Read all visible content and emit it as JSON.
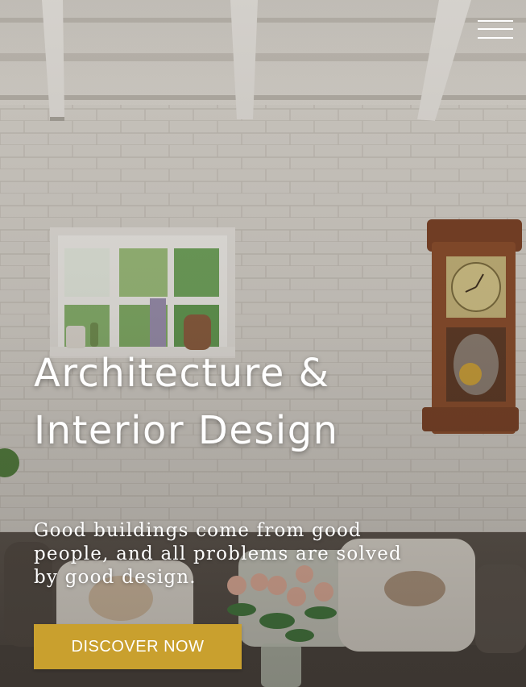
{
  "hero": {
    "headline": "Architecture & Interior Design",
    "tagline": "Good buildings come from good people, and all problems are solved by good design.",
    "cta_label": "DISCOVER NOW"
  },
  "header": {
    "menu_icon": "hamburger-menu-icon"
  },
  "colors": {
    "accent": "#c9a02e",
    "text": "#ffffff"
  }
}
